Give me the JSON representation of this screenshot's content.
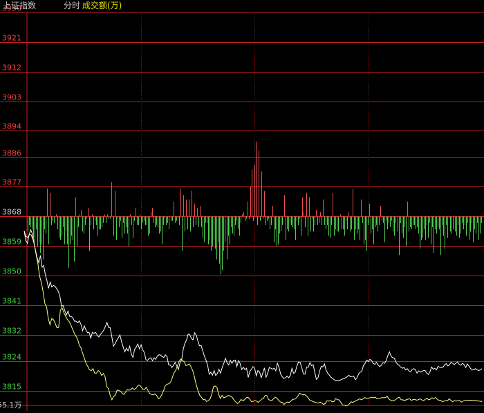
{
  "header": {
    "index_name": "上证指数",
    "mode": "分时",
    "indicator": "成交额(万)"
  },
  "colors": {
    "background": "#000000",
    "grid": "#c81e1e",
    "grid_dashed": "#8a1c1c",
    "up": "#f05050",
    "down": "#50d050",
    "price_line": "#ffffff",
    "avg_line": "#ffff80",
    "header_text": "#c8c8c8",
    "indicator_text": "#e0e000",
    "red_label": "#ff3c3c",
    "green_label": "#40d040",
    "neutral_label": "#c8c8c8"
  },
  "bottom_label": "55.1万",
  "chart_data": {
    "type": "line",
    "title": "上证指数 分时",
    "ylim": [
      3810.5,
      3930
    ],
    "base": 3868,
    "y_ticks": [
      "3930",
      "3921",
      "3912",
      "3903",
      "3894",
      "3886",
      "3877",
      "3868",
      "3859",
      "3850",
      "3841",
      "3832",
      "3824",
      "3815"
    ],
    "y_tick_values": [
      3930,
      3921,
      3912,
      3903,
      3894,
      3886,
      3877,
      3868,
      3859,
      3850,
      3841,
      3832,
      3824,
      3815
    ],
    "vertical_gridlines": 4,
    "volume_bars": [
      -7,
      -4,
      -5,
      -6,
      -10,
      -12,
      -6,
      -14,
      -12,
      -17,
      -13,
      -20,
      -6,
      -8,
      13,
      -13,
      11,
      -4,
      -2,
      -3,
      1,
      -6,
      -10,
      -11,
      -9,
      -5,
      -13,
      -7,
      -13,
      -24,
      -13,
      -9,
      -11,
      -21,
      9,
      -14,
      -5,
      1,
      3,
      -7,
      -8,
      -4,
      -1,
      4,
      -16,
      -4,
      1,
      -6,
      -2,
      -4,
      -9,
      -6,
      -6,
      -5,
      -3,
      1,
      -3,
      1,
      -1,
      -1,
      16,
      -9,
      12,
      -11,
      -1,
      -5,
      -2,
      -10,
      -3,
      -8,
      -5,
      -8,
      -14,
      1,
      -4,
      -10,
      -2,
      4,
      -4,
      -4,
      1,
      -6,
      -3,
      -2,
      -4,
      -4,
      -9,
      -8,
      2,
      4,
      -3,
      -5,
      -4,
      -5,
      -8,
      -7,
      -13,
      -4,
      -1,
      -4,
      -3,
      -6,
      -2,
      -2,
      7,
      -3,
      -2,
      -1,
      -4,
      13,
      -16,
      10,
      -7,
      8,
      -6,
      8,
      -7,
      12,
      -5,
      6,
      -4,
      4,
      -5,
      5,
      -5,
      -10,
      -12,
      -3,
      -3,
      -13,
      -11,
      -16,
      -14,
      -11,
      -15,
      -20,
      -12,
      -22,
      -27,
      -25,
      -16,
      -12,
      -20,
      -9,
      -13,
      -5,
      -8,
      -9,
      -4,
      -2,
      -6,
      -9,
      -3,
      1,
      2,
      -2,
      -1,
      7,
      -1,
      14,
      22,
      -2,
      24,
      35,
      -4,
      31,
      -2,
      21,
      -1,
      12,
      -4,
      -2,
      -1,
      -6,
      -4,
      5,
      -12,
      -6,
      -14,
      -13,
      -8,
      -7,
      -4,
      10,
      -11,
      -6,
      -7,
      -3,
      -4,
      -5,
      -6,
      -11,
      -2,
      -4,
      -1,
      -9,
      9,
      2,
      -5,
      11,
      -9,
      9,
      -7,
      -1,
      -7,
      -4,
      3,
      -4,
      -3,
      2,
      -4,
      8,
      -4,
      -6,
      -4,
      -9,
      -10,
      -4,
      11,
      -9,
      -6,
      -7,
      -7,
      1,
      -6,
      -6,
      -9,
      -2,
      -6,
      2,
      -7,
      -6,
      13,
      -11,
      -6,
      -8,
      -6,
      -11,
      8,
      -3,
      -13,
      -11,
      -16,
      -4,
      6,
      -8,
      -6,
      -13,
      -5,
      -4,
      -7,
      -4,
      5,
      -2,
      -3,
      -12,
      -2,
      -6,
      -3,
      -5,
      -2,
      -7,
      -9,
      -3,
      -7,
      -18,
      -3,
      -8,
      -10,
      -5,
      -14,
      7,
      -7,
      -5,
      -6,
      -4,
      -4,
      -6,
      -5,
      -8,
      -15,
      -11,
      -10,
      -6,
      -11,
      -4,
      -10,
      -3,
      -13,
      -5,
      -17,
      -6,
      -8,
      -5,
      -6,
      -18,
      -4,
      -9,
      -15,
      -4,
      -10,
      -1,
      -7,
      -8,
      -6,
      -7,
      -9,
      -4,
      -10,
      -8,
      -3,
      -6,
      -4,
      -9,
      -3,
      -11,
      -7,
      -3,
      -12,
      -6,
      -8,
      -3,
      -11,
      -8,
      -3
    ],
    "price": [
      3863.5,
      3860.6,
      3859.8,
      3862.4,
      3863.9,
      3862.7,
      3860.1,
      3857.6,
      3855.3,
      3853.9,
      3856.1,
      3852.5,
      3853.1,
      3850.3,
      3848.4,
      3846.1,
      3848.0,
      3846.5,
      3847.0,
      3846.7,
      3846.0,
      3845.2,
      3843.7,
      3840.6,
      3840.9,
      3839.3,
      3838.0,
      3839.2,
      3837.6,
      3837.5,
      3837.1,
      3836.1,
      3836.1,
      3835.6,
      3836.2,
      3835.1,
      3833.2,
      3834.7,
      3833.5,
      3832.6,
      3832.7,
      3831.0,
      3832.7,
      3832.4,
      3832.7,
      3831.8,
      3831.3,
      3832.1,
      3832.7,
      3833.4,
      3834.5,
      3835.7,
      3834.2,
      3834.1,
      3831.3,
      3828.5,
      3829.3,
      3830.3,
      3831.1,
      3831.9,
      3829.8,
      3828.2,
      3826.8,
      3827.9,
      3827.1,
      3828.5,
      3826.1,
      3825.1,
      3827.5,
      3828.2,
      3829.2,
      3827.7,
      3828.9,
      3827.4,
      3826.6,
      3824.4,
      3824.2,
      3824.8,
      3825.0,
      3824.1,
      3825.0,
      3824.5,
      3825.5,
      3825.9,
      3825.8,
      3825.3,
      3825.1,
      3825.9,
      3825.3,
      3822.8,
      3822.8,
      3822.0,
      3822.7,
      3823.6,
      3822.5,
      3821.4,
      3823.6,
      3824.3,
      3827.7,
      3829.4,
      3830.4,
      3832.2,
      3832.0,
      3830.9,
      3830.4,
      3832.6,
      3831.9,
      3830.1,
      3828.6,
      3828.7,
      3827.1,
      3825.5,
      3824.3,
      3822.7,
      3820.0,
      3820.6,
      3819.7,
      3821.1,
      3819.6,
      3820.2,
      3821.5,
      3820.3,
      3822.1,
      3823.3,
      3824.8,
      3823.5,
      3822.8,
      3824.2,
      3823.3,
      3824.2,
      3824.3,
      3822.3,
      3824.1,
      3823.3,
      3821.4,
      3822.1,
      3821.4,
      3821.8,
      3819.0,
      3820.9,
      3821.5,
      3822.3,
      3821.8,
      3819.5,
      3821.1,
      3820.7,
      3818.9,
      3820.3,
      3821.9,
      3819.1,
      3820.2,
      3822.0,
      3821.8,
      3821.5,
      3821.8,
      3821.0,
      3823.3,
      3822.0,
      3820.0,
      3819.2,
      3818.7,
      3818.9,
      3819.4,
      3818.9,
      3819.7,
      3821.8,
      3820.2,
      3820.6,
      3822.5,
      3823.7,
      3823.6,
      3822.0,
      3820.1,
      3820.0,
      3822.2,
      3822.1,
      3823.5,
      3822.6,
      3822.9,
      3820.6,
      3818.4,
      3818.9,
      3820.9,
      3822.4,
      3822.2,
      3823.1,
      3821.2,
      3820.3,
      3819.7,
      3819.1,
      3818.7,
      3818.3,
      3818.0,
      3818.1,
      3818.0,
      3818.3,
      3818.5,
      3818.6,
      3818.9,
      3819.2,
      3819.7,
      3819.2,
      3819.3,
      3819.4,
      3818.3,
      3818.9,
      3820.0,
      3820.6,
      3820.9,
      3822.6,
      3823.3,
      3824.3,
      3823.8,
      3824.5,
      3824.2,
      3823.3,
      3823.0,
      3823.6,
      3822.8,
      3822.3,
      3822.7,
      3823.5,
      3823.3,
      3824.1,
      3825.6,
      3826.8,
      3825.5,
      3825.0,
      3824.9,
      3823.7,
      3823.0,
      3822.7,
      3822.1,
      3821.8,
      3822.0,
      3821.3,
      3821.7,
      3821.0,
      3820.7,
      3821.4,
      3821.7,
      3821.3,
      3820.3,
      3821.0,
      3820.6,
      3820.8,
      3821.1,
      3821.1,
      3820.3,
      3819.9,
      3820.7,
      3822.2,
      3821.5,
      3821.8,
      3821.3,
      3822.4,
      3822.1,
      3822.0,
      3822.1,
      3822.8,
      3823.2,
      3822.5,
      3822.8,
      3823.6,
      3823.3,
      3822.9,
      3823.4,
      3823.7,
      3823.0,
      3822.7,
      3823.3,
      3822.9,
      3822.0,
      3823.1,
      3822.5,
      3821.7,
      3821.4,
      3821.3,
      3821.7,
      3821.3,
      3821.1,
      3821.3,
      3821.7
    ],
    "avg": [
      3863.6,
      3861.9,
      3861.6,
      3862.4,
      3862.4,
      3861.1,
      3859.2,
      3856.2,
      3853.5,
      3849.7,
      3847.8,
      3845.0,
      3841.5,
      3840.4,
      3837.0,
      3835.0,
      3836.9,
      3836.6,
      3835.5,
      3834.1,
      3834.2,
      3839.4,
      3840.2,
      3838.8,
      3837.7,
      3836.7,
      3836.1,
      3835.1,
      3833.8,
      3832.6,
      3831.6,
      3830.7,
      3828.9,
      3828.0,
      3826.3,
      3824.8,
      3823.2,
      3822.3,
      3821.3,
      3821.1,
      3821.7,
      3820.3,
      3820.3,
      3821.1,
      3820.7,
      3819.6,
      3820.2,
      3819.2,
      3816.2,
      3815.6,
      3813.5,
      3812.2,
      3813.3,
      3813.6,
      3815.2,
      3815.0,
      3814.8,
      3814.2,
      3813.8,
      3814.6,
      3815.3,
      3815.1,
      3815.4,
      3815.8,
      3815.3,
      3815.7,
      3816.5,
      3816.7,
      3816.1,
      3815.4,
      3815.4,
      3816.0,
      3814.9,
      3814.1,
      3813.8,
      3813.7,
      3814.0,
      3813.5,
      3812.5,
      3812.9,
      3813.8,
      3815.0,
      3816.5,
      3816.9,
      3817.1,
      3817.5,
      3818.8,
      3820.4,
      3821.1,
      3822.5,
      3823.9,
      3824.6,
      3824.1,
      3823.8,
      3822.6,
      3822.8,
      3823.1,
      3822.2,
      3821.0,
      3819.0,
      3816.7,
      3815.0,
      3813.6,
      3813.0,
      3812.2,
      3812.4,
      3811.7,
      3812.0,
      3812.5,
      3813.9,
      3816.2,
      3816.4,
      3816.0,
      3813.9,
      3812.6,
      3813.5,
      3812.8,
      3813.0,
      3813.4,
      3813.5,
      3813.3,
      3812.9,
      3812.1,
      3811.5,
      3811.0,
      3811.5,
      3812.3,
      3812.0,
      3812.2,
      3812.8,
      3813.0,
      3812.5,
      3811.7,
      3811.7,
      3812.0,
      3811.8,
      3811.4,
      3811.9,
      3812.4,
      3812.6,
      3813.5,
      3813.5,
      3812.3,
      3812.0,
      3812.0,
      3812.6,
      3813.0,
      3812.6,
      3812.0,
      3811.5,
      3811.4,
      3810.8,
      3811.3,
      3811.5,
      3811.4,
      3811.8,
      3812.3,
      3812.4,
      3812.7,
      3813.3,
      3814.2,
      3813.9,
      3813.7,
      3813.8,
      3813.4,
      3812.8,
      3812.1,
      3811.9,
      3811.6,
      3811.5,
      3811.3,
      3811.2,
      3811.5,
      3811.2,
      3810.8,
      3811.1,
      3811.9,
      3811.8,
      3812.0,
      3811.6,
      3811.7,
      3812.6,
      3812.2,
      3812.2,
      3811.4,
      3810.6,
      3810.6,
      3810.3,
      3810.5,
      3811.0,
      3811.6,
      3811.4,
      3811.7,
      3812.0,
      3812.2,
      3812.5,
      3812.2,
      3812.5,
      3812.9,
      3812.6,
      3812.7,
      3812.8,
      3813.0,
      3812.8,
      3813.0,
      3812.5,
      3812.6,
      3812.7,
      3812.9,
      3812.8,
      3812.9,
      3813.2,
      3812.4,
      3812.1,
      3811.9,
      3812.0,
      3812.3,
      3812.8,
      3813.0,
      3812.2,
      3812.2,
      3812.0,
      3812.2,
      3812.4,
      3812.5,
      3812.0,
      3812.3,
      3812.3,
      3812.1,
      3812.2,
      3812.5,
      3812.2,
      3811.9,
      3812.3,
      3812.7,
      3812.2,
      3812.4,
      3812.8,
      3812.6,
      3812.9,
      3812.4,
      3812.0,
      3812.1,
      3811.6,
      3811.8,
      3812.0,
      3811.9,
      3812.5,
      3812.0,
      3811.6,
      3812.0,
      3811.8,
      3812.0,
      3812.0,
      3811.5,
      3811.8,
      3812.0,
      3812.0,
      3812.1,
      3812.0,
      3812.1,
      3812.0,
      3812.0,
      3812.0,
      3811.8,
      3811.8,
      3811.6
    ]
  }
}
